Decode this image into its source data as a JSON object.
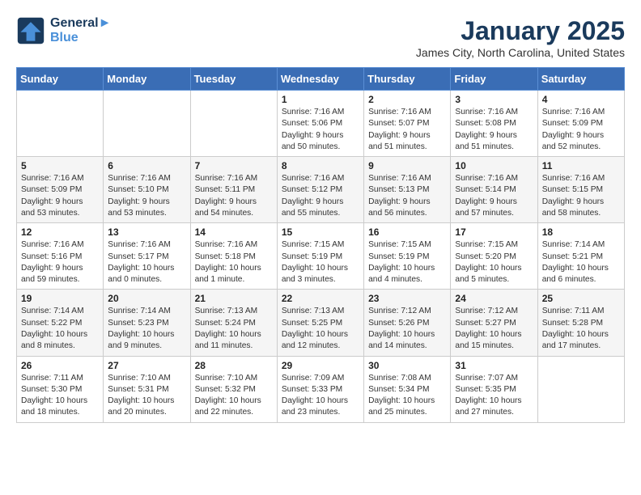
{
  "header": {
    "logo_line1": "General",
    "logo_line2": "Blue",
    "month": "January 2025",
    "location": "James City, North Carolina, United States"
  },
  "days_of_week": [
    "Sunday",
    "Monday",
    "Tuesday",
    "Wednesday",
    "Thursday",
    "Friday",
    "Saturday"
  ],
  "weeks": [
    [
      {
        "num": "",
        "detail": ""
      },
      {
        "num": "",
        "detail": ""
      },
      {
        "num": "",
        "detail": ""
      },
      {
        "num": "1",
        "detail": "Sunrise: 7:16 AM\nSunset: 5:06 PM\nDaylight: 9 hours\nand 50 minutes."
      },
      {
        "num": "2",
        "detail": "Sunrise: 7:16 AM\nSunset: 5:07 PM\nDaylight: 9 hours\nand 51 minutes."
      },
      {
        "num": "3",
        "detail": "Sunrise: 7:16 AM\nSunset: 5:08 PM\nDaylight: 9 hours\nand 51 minutes."
      },
      {
        "num": "4",
        "detail": "Sunrise: 7:16 AM\nSunset: 5:09 PM\nDaylight: 9 hours\nand 52 minutes."
      }
    ],
    [
      {
        "num": "5",
        "detail": "Sunrise: 7:16 AM\nSunset: 5:09 PM\nDaylight: 9 hours\nand 53 minutes."
      },
      {
        "num": "6",
        "detail": "Sunrise: 7:16 AM\nSunset: 5:10 PM\nDaylight: 9 hours\nand 53 minutes."
      },
      {
        "num": "7",
        "detail": "Sunrise: 7:16 AM\nSunset: 5:11 PM\nDaylight: 9 hours\nand 54 minutes."
      },
      {
        "num": "8",
        "detail": "Sunrise: 7:16 AM\nSunset: 5:12 PM\nDaylight: 9 hours\nand 55 minutes."
      },
      {
        "num": "9",
        "detail": "Sunrise: 7:16 AM\nSunset: 5:13 PM\nDaylight: 9 hours\nand 56 minutes."
      },
      {
        "num": "10",
        "detail": "Sunrise: 7:16 AM\nSunset: 5:14 PM\nDaylight: 9 hours\nand 57 minutes."
      },
      {
        "num": "11",
        "detail": "Sunrise: 7:16 AM\nSunset: 5:15 PM\nDaylight: 9 hours\nand 58 minutes."
      }
    ],
    [
      {
        "num": "12",
        "detail": "Sunrise: 7:16 AM\nSunset: 5:16 PM\nDaylight: 9 hours\nand 59 minutes."
      },
      {
        "num": "13",
        "detail": "Sunrise: 7:16 AM\nSunset: 5:17 PM\nDaylight: 10 hours\nand 0 minutes."
      },
      {
        "num": "14",
        "detail": "Sunrise: 7:16 AM\nSunset: 5:18 PM\nDaylight: 10 hours\nand 1 minute."
      },
      {
        "num": "15",
        "detail": "Sunrise: 7:15 AM\nSunset: 5:19 PM\nDaylight: 10 hours\nand 3 minutes."
      },
      {
        "num": "16",
        "detail": "Sunrise: 7:15 AM\nSunset: 5:19 PM\nDaylight: 10 hours\nand 4 minutes."
      },
      {
        "num": "17",
        "detail": "Sunrise: 7:15 AM\nSunset: 5:20 PM\nDaylight: 10 hours\nand 5 minutes."
      },
      {
        "num": "18",
        "detail": "Sunrise: 7:14 AM\nSunset: 5:21 PM\nDaylight: 10 hours\nand 6 minutes."
      }
    ],
    [
      {
        "num": "19",
        "detail": "Sunrise: 7:14 AM\nSunset: 5:22 PM\nDaylight: 10 hours\nand 8 minutes."
      },
      {
        "num": "20",
        "detail": "Sunrise: 7:14 AM\nSunset: 5:23 PM\nDaylight: 10 hours\nand 9 minutes."
      },
      {
        "num": "21",
        "detail": "Sunrise: 7:13 AM\nSunset: 5:24 PM\nDaylight: 10 hours\nand 11 minutes."
      },
      {
        "num": "22",
        "detail": "Sunrise: 7:13 AM\nSunset: 5:25 PM\nDaylight: 10 hours\nand 12 minutes."
      },
      {
        "num": "23",
        "detail": "Sunrise: 7:12 AM\nSunset: 5:26 PM\nDaylight: 10 hours\nand 14 minutes."
      },
      {
        "num": "24",
        "detail": "Sunrise: 7:12 AM\nSunset: 5:27 PM\nDaylight: 10 hours\nand 15 minutes."
      },
      {
        "num": "25",
        "detail": "Sunrise: 7:11 AM\nSunset: 5:28 PM\nDaylight: 10 hours\nand 17 minutes."
      }
    ],
    [
      {
        "num": "26",
        "detail": "Sunrise: 7:11 AM\nSunset: 5:30 PM\nDaylight: 10 hours\nand 18 minutes."
      },
      {
        "num": "27",
        "detail": "Sunrise: 7:10 AM\nSunset: 5:31 PM\nDaylight: 10 hours\nand 20 minutes."
      },
      {
        "num": "28",
        "detail": "Sunrise: 7:10 AM\nSunset: 5:32 PM\nDaylight: 10 hours\nand 22 minutes."
      },
      {
        "num": "29",
        "detail": "Sunrise: 7:09 AM\nSunset: 5:33 PM\nDaylight: 10 hours\nand 23 minutes."
      },
      {
        "num": "30",
        "detail": "Sunrise: 7:08 AM\nSunset: 5:34 PM\nDaylight: 10 hours\nand 25 minutes."
      },
      {
        "num": "31",
        "detail": "Sunrise: 7:07 AM\nSunset: 5:35 PM\nDaylight: 10 hours\nand 27 minutes."
      },
      {
        "num": "",
        "detail": ""
      }
    ]
  ]
}
